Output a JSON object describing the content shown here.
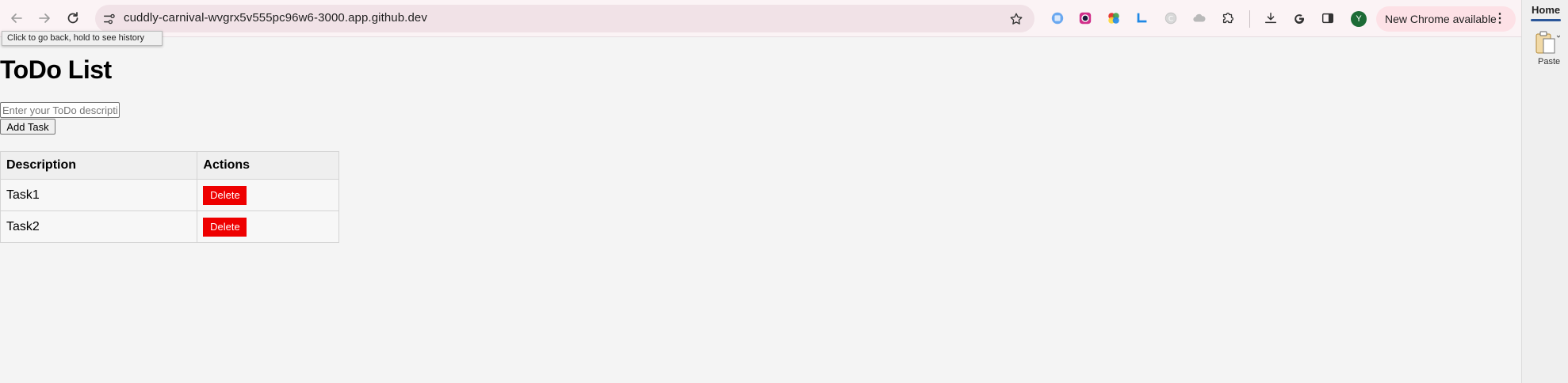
{
  "browser": {
    "url": "cuddly-carnival-wvgrx5v555pc96w6-3000.app.github.dev",
    "tooltip": "Click to go back, hold to see history",
    "update_button": "New Chrome available",
    "avatar_initial": "Y",
    "extensions": [
      "translate-extension-icon",
      "camera-extension-icon",
      "color-wheel-extension-icon",
      "chart-extension-icon",
      "grey-circle-extension-icon",
      "cloud-extension-icon",
      "puzzle-icon"
    ]
  },
  "sidepanel": {
    "tab": "Home",
    "paste_label": "Paste"
  },
  "page": {
    "title": "ToDo List",
    "input_placeholder": "Enter your ToDo description",
    "add_button": "Add Task",
    "table": {
      "headers": [
        "Description",
        "Actions"
      ],
      "rows": [
        {
          "description": "Task1",
          "action": "Delete"
        },
        {
          "description": "Task2",
          "action": "Delete"
        }
      ]
    }
  },
  "colors": {
    "delete_button": "#ee0000",
    "page_background": "#f4f4f4"
  }
}
